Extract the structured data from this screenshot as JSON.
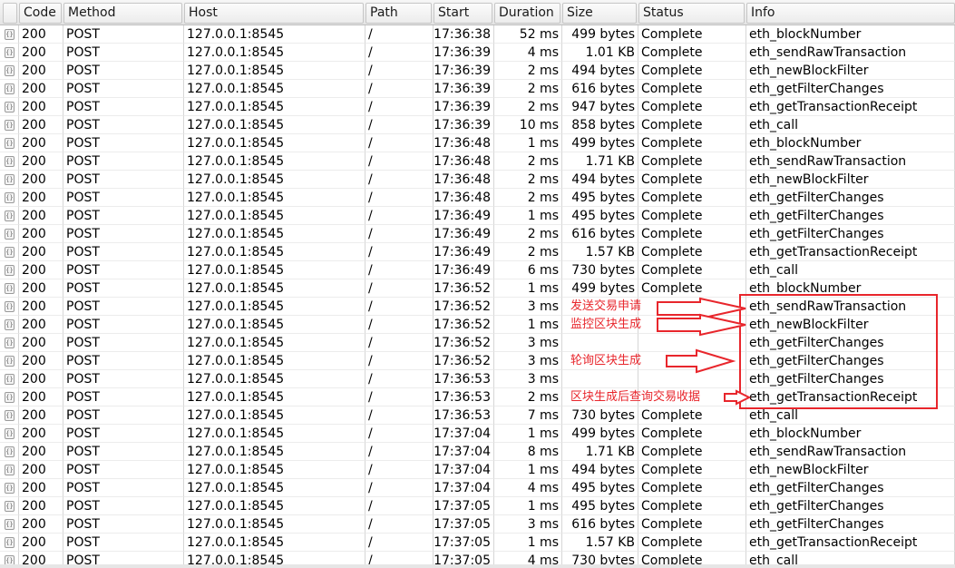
{
  "columns": [
    "",
    "Code",
    "Method",
    "Host",
    "Path",
    "Start",
    "Duration",
    "Size",
    "Status",
    "Info"
  ],
  "rows": [
    {
      "code": "200",
      "method": "POST",
      "host": "127.0.0.1:8545",
      "path": "/",
      "start": "17:36:38",
      "duration": "52 ms",
      "size": "499 bytes",
      "status": "Complete",
      "info": "eth_blockNumber"
    },
    {
      "code": "200",
      "method": "POST",
      "host": "127.0.0.1:8545",
      "path": "/",
      "start": "17:36:39",
      "duration": "4 ms",
      "size": "1.01 KB",
      "status": "Complete",
      "info": "eth_sendRawTransaction"
    },
    {
      "code": "200",
      "method": "POST",
      "host": "127.0.0.1:8545",
      "path": "/",
      "start": "17:36:39",
      "duration": "2 ms",
      "size": "494 bytes",
      "status": "Complete",
      "info": "eth_newBlockFilter"
    },
    {
      "code": "200",
      "method": "POST",
      "host": "127.0.0.1:8545",
      "path": "/",
      "start": "17:36:39",
      "duration": "2 ms",
      "size": "616 bytes",
      "status": "Complete",
      "info": "eth_getFilterChanges"
    },
    {
      "code": "200",
      "method": "POST",
      "host": "127.0.0.1:8545",
      "path": "/",
      "start": "17:36:39",
      "duration": "2 ms",
      "size": "947 bytes",
      "status": "Complete",
      "info": "eth_getTransactionReceipt"
    },
    {
      "code": "200",
      "method": "POST",
      "host": "127.0.0.1:8545",
      "path": "/",
      "start": "17:36:39",
      "duration": "10 ms",
      "size": "858 bytes",
      "status": "Complete",
      "info": "eth_call"
    },
    {
      "code": "200",
      "method": "POST",
      "host": "127.0.0.1:8545",
      "path": "/",
      "start": "17:36:48",
      "duration": "1 ms",
      "size": "499 bytes",
      "status": "Complete",
      "info": "eth_blockNumber"
    },
    {
      "code": "200",
      "method": "POST",
      "host": "127.0.0.1:8545",
      "path": "/",
      "start": "17:36:48",
      "duration": "2 ms",
      "size": "1.71 KB",
      "status": "Complete",
      "info": "eth_sendRawTransaction"
    },
    {
      "code": "200",
      "method": "POST",
      "host": "127.0.0.1:8545",
      "path": "/",
      "start": "17:36:48",
      "duration": "2 ms",
      "size": "494 bytes",
      "status": "Complete",
      "info": "eth_newBlockFilter"
    },
    {
      "code": "200",
      "method": "POST",
      "host": "127.0.0.1:8545",
      "path": "/",
      "start": "17:36:48",
      "duration": "2 ms",
      "size": "495 bytes",
      "status": "Complete",
      "info": "eth_getFilterChanges"
    },
    {
      "code": "200",
      "method": "POST",
      "host": "127.0.0.1:8545",
      "path": "/",
      "start": "17:36:49",
      "duration": "1 ms",
      "size": "495 bytes",
      "status": "Complete",
      "info": "eth_getFilterChanges"
    },
    {
      "code": "200",
      "method": "POST",
      "host": "127.0.0.1:8545",
      "path": "/",
      "start": "17:36:49",
      "duration": "2 ms",
      "size": "616 bytes",
      "status": "Complete",
      "info": "eth_getFilterChanges"
    },
    {
      "code": "200",
      "method": "POST",
      "host": "127.0.0.1:8545",
      "path": "/",
      "start": "17:36:49",
      "duration": "2 ms",
      "size": "1.57 KB",
      "status": "Complete",
      "info": "eth_getTransactionReceipt"
    },
    {
      "code": "200",
      "method": "POST",
      "host": "127.0.0.1:8545",
      "path": "/",
      "start": "17:36:49",
      "duration": "6 ms",
      "size": "730 bytes",
      "status": "Complete",
      "info": "eth_call"
    },
    {
      "code": "200",
      "method": "POST",
      "host": "127.0.0.1:8545",
      "path": "/",
      "start": "17:36:52",
      "duration": "1 ms",
      "size": "499 bytes",
      "status": "Complete",
      "info": "eth_blockNumber"
    },
    {
      "code": "200",
      "method": "POST",
      "host": "127.0.0.1:8545",
      "path": "/",
      "start": "17:36:52",
      "duration": "3 ms",
      "size": "",
      "status": "",
      "info": "eth_sendRawTransaction"
    },
    {
      "code": "200",
      "method": "POST",
      "host": "127.0.0.1:8545",
      "path": "/",
      "start": "17:36:52",
      "duration": "1 ms",
      "size": "",
      "status": "",
      "info": "eth_newBlockFilter"
    },
    {
      "code": "200",
      "method": "POST",
      "host": "127.0.0.1:8545",
      "path": "/",
      "start": "17:36:52",
      "duration": "3 ms",
      "size": "",
      "status": "",
      "info": "eth_getFilterChanges"
    },
    {
      "code": "200",
      "method": "POST",
      "host": "127.0.0.1:8545",
      "path": "/",
      "start": "17:36:52",
      "duration": "3 ms",
      "size": "",
      "status": "",
      "info": "eth_getFilterChanges"
    },
    {
      "code": "200",
      "method": "POST",
      "host": "127.0.0.1:8545",
      "path": "/",
      "start": "17:36:53",
      "duration": "3 ms",
      "size": "",
      "status": "",
      "info": "eth_getFilterChanges"
    },
    {
      "code": "200",
      "method": "POST",
      "host": "127.0.0.1:8545",
      "path": "/",
      "start": "17:36:53",
      "duration": "2 ms",
      "size": "",
      "status": "",
      "info": "eth_getTransactionReceipt"
    },
    {
      "code": "200",
      "method": "POST",
      "host": "127.0.0.1:8545",
      "path": "/",
      "start": "17:36:53",
      "duration": "7 ms",
      "size": "730 bytes",
      "status": "Complete",
      "info": "eth_call"
    },
    {
      "code": "200",
      "method": "POST",
      "host": "127.0.0.1:8545",
      "path": "/",
      "start": "17:37:04",
      "duration": "1 ms",
      "size": "499 bytes",
      "status": "Complete",
      "info": "eth_blockNumber"
    },
    {
      "code": "200",
      "method": "POST",
      "host": "127.0.0.1:8545",
      "path": "/",
      "start": "17:37:04",
      "duration": "8 ms",
      "size": "1.71 KB",
      "status": "Complete",
      "info": "eth_sendRawTransaction"
    },
    {
      "code": "200",
      "method": "POST",
      "host": "127.0.0.1:8545",
      "path": "/",
      "start": "17:37:04",
      "duration": "1 ms",
      "size": "494 bytes",
      "status": "Complete",
      "info": "eth_newBlockFilter"
    },
    {
      "code": "200",
      "method": "POST",
      "host": "127.0.0.1:8545",
      "path": "/",
      "start": "17:37:04",
      "duration": "4 ms",
      "size": "495 bytes",
      "status": "Complete",
      "info": "eth_getFilterChanges"
    },
    {
      "code": "200",
      "method": "POST",
      "host": "127.0.0.1:8545",
      "path": "/",
      "start": "17:37:05",
      "duration": "1 ms",
      "size": "495 bytes",
      "status": "Complete",
      "info": "eth_getFilterChanges"
    },
    {
      "code": "200",
      "method": "POST",
      "host": "127.0.0.1:8545",
      "path": "/",
      "start": "17:37:05",
      "duration": "3 ms",
      "size": "616 bytes",
      "status": "Complete",
      "info": "eth_getFilterChanges"
    },
    {
      "code": "200",
      "method": "POST",
      "host": "127.0.0.1:8545",
      "path": "/",
      "start": "17:37:05",
      "duration": "1 ms",
      "size": "1.57 KB",
      "status": "Complete",
      "info": "eth_getTransactionReceipt"
    },
    {
      "code": "200",
      "method": "POST",
      "host": "127.0.0.1:8545",
      "path": "/",
      "start": "17:37:05",
      "duration": "4 ms",
      "size": "730 bytes",
      "status": "Complete",
      "info": "eth_call"
    }
  ],
  "annotations": [
    {
      "text": "发送交易申请"
    },
    {
      "text": "监控区块生成"
    },
    {
      "text": "轮询区块生成"
    },
    {
      "text": "区块生成后查询交易收据"
    }
  ],
  "colors": {
    "annotation": "#e8262c",
    "header_bg": "#ececec",
    "grid": "#d6d6d6"
  },
  "icons": {
    "row_icon": "json-file-icon"
  }
}
